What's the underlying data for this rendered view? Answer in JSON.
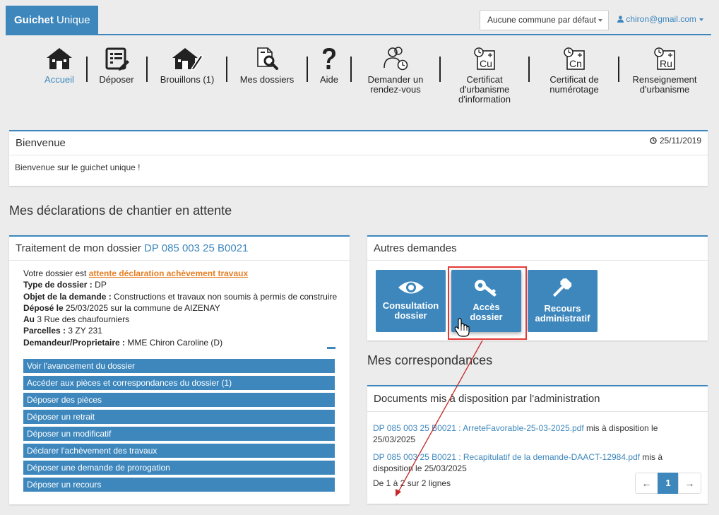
{
  "header": {
    "brand_bold": "Guichet",
    "brand_rest": " Unique",
    "commune_select": "Aucune commune par défaut",
    "user": "chiron@gmail.com"
  },
  "nav": [
    {
      "label": "Accueil",
      "icon": "home-icon"
    },
    {
      "label": "Déposer",
      "icon": "form-edit-icon"
    },
    {
      "label": "Brouillons (1)",
      "icon": "home-pencil-icon"
    },
    {
      "label": "Mes dossiers",
      "icon": "document-search-icon"
    },
    {
      "label": "Aide",
      "icon": "question-icon"
    },
    {
      "label_line1": "Demander un",
      "label_line2": "rendez-vous",
      "icon": "users-clock-icon"
    },
    {
      "label_line1": "Certificat",
      "label_line2": "d'urbanisme",
      "label_line3": "d'information",
      "icon": "cu-icon",
      "icon_text": "Cu"
    },
    {
      "label_line1": "Certificat de",
      "label_line2": "numérotage",
      "icon": "cn-icon",
      "icon_text": "Cn"
    },
    {
      "label_line1": "Renseignement",
      "label_line2": "d'urbanisme",
      "icon": "ru-icon",
      "icon_text": "Ru"
    }
  ],
  "welcome": {
    "title": "Bienvenue",
    "date": "25/11/2019",
    "message": "Bienvenue sur le guichet unique !"
  },
  "declarations": {
    "section_title": "Mes déclarations de chantier en attente",
    "panel_title_prefix": "Traitement de mon dossier ",
    "dossier_number": "DP 085 003 25 B0021",
    "status_prefix": "Votre dossier est ",
    "status_value": "attente déclaration achèvement travaux",
    "type_label": "Type de dossier :",
    "type_value": " DP",
    "objet_label": "Objet de la demande :",
    "objet_value": " Constructions et travaux non soumis à permis de construire",
    "depose_label": "Déposé le",
    "depose_value": " 25/03/2025 sur la commune de AIZENAY",
    "au_label": "Au",
    "au_value": " 3 Rue des chaufourniers",
    "parcelles_label": "Parcelles :",
    "parcelles_value": " 3 ZY 231",
    "demandeur_label": "Demandeur/Proprietaire :",
    "demandeur_value": " MME Chiron Caroline (D)",
    "actions": [
      "Voir l'avancement du dossier",
      "Accéder aux pièces et correspondances du dossier (1)",
      "Déposer des pièces",
      "Déposer un retrait",
      "Déposer un modificatif",
      "Déclarer l'achèvement des travaux",
      "Déposer une demande de prorogation",
      "Déposer un recours"
    ]
  },
  "autres": {
    "title": "Autres demandes",
    "tiles": [
      {
        "line1": "Consultation",
        "line2": "dossier",
        "icon": "eye-icon"
      },
      {
        "line1": "Accès",
        "line2": "dossier",
        "icon": "key-icon"
      },
      {
        "line1": "Recours",
        "line2": "administratif",
        "icon": "gavel-icon"
      }
    ]
  },
  "correspondances": {
    "section_title": "Mes correspondances",
    "panel_title": "Documents mis à disposition par l'administration",
    "docs": [
      {
        "link": "DP 085 003 25 B0021 : ArreteFavorable-25-03-2025.pdf",
        "suffix": " mis à disposition le 25/03/2025"
      },
      {
        "link": "DP 085 003 25 B0021 : Recapitulatif de la demande-DAACT-12984.pdf",
        "suffix": " mis à disposition le 25/03/2025"
      }
    ],
    "count": "De 1 à 2 sur 2 lignes",
    "pager": {
      "prev": "←",
      "page": "1",
      "next": "→"
    }
  },
  "colors": {
    "accent": "#3d87bd",
    "status_orange": "#e67e22",
    "highlight_red": "#e53935",
    "arrow": "#c62828"
  }
}
